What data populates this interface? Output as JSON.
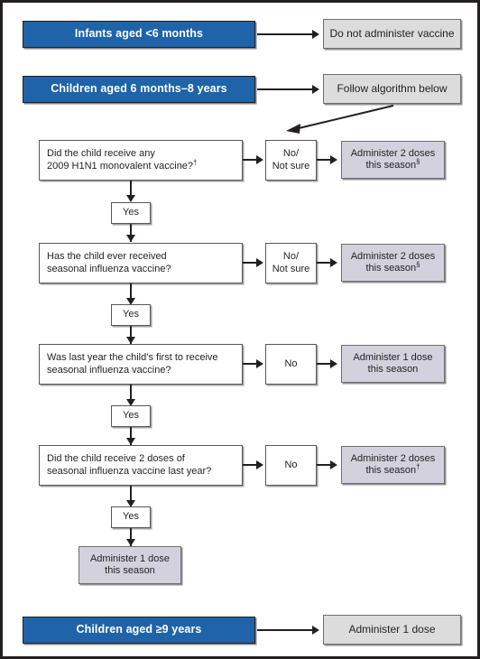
{
  "figure": {
    "colors": {
      "banner_blue": "#1f63a8",
      "outcome_grey": "#dcdcdc",
      "result_lavender": "#d4d1de",
      "line_black": "#231f20",
      "box_border_grey": "#58585a"
    }
  },
  "top": {
    "infants_banner": "Infants aged <6 months",
    "infants_outcome": "Do not administer vaccine",
    "children_banner": "Children aged 6 months–8 years",
    "children_outcome": "Follow algorithm below"
  },
  "algorithm": {
    "steps": [
      {
        "question_line1": "Did the child receive any",
        "question_line2": "2009 H1N1 monovalent vaccine?",
        "question_sup": "†",
        "branch_no_line1": "No/",
        "branch_no_line2": "Not sure",
        "result_line1": "Administer 2 doses",
        "result_line2": "this season",
        "result_sup": "§",
        "branch_yes": "Yes"
      },
      {
        "question_line1": "Has the child ever received",
        "question_line2": "seasonal influenza vaccine?",
        "question_sup": "",
        "branch_no_line1": "No/",
        "branch_no_line2": "Not sure",
        "result_line1": "Administer 2 doses",
        "result_line2": "this season",
        "result_sup": "§",
        "branch_yes": "Yes"
      },
      {
        "question_line1": "Was last year the child’s first to receive",
        "question_line2": "seasonal influenza vaccine?",
        "question_sup": "",
        "branch_no_line1": "No",
        "branch_no_line2": "",
        "result_line1": "Administer 1 dose",
        "result_line2": "this season",
        "result_sup": "",
        "branch_yes": "Yes"
      },
      {
        "question_line1": "Did the child receive 2 doses of",
        "question_line2": "seasonal influenza vaccine last year?",
        "question_sup": "",
        "branch_no_line1": "No",
        "branch_no_line2": "",
        "result_line1": "Administer 2 doses",
        "result_line2": "this season",
        "result_sup": "†",
        "branch_yes": "Yes"
      }
    ],
    "final_result_line1": "Administer 1 dose",
    "final_result_line2": "this season"
  },
  "bottom": {
    "children9_banner": "Children  aged ≥9 years",
    "children9_outcome": "Administer 1 dose"
  }
}
